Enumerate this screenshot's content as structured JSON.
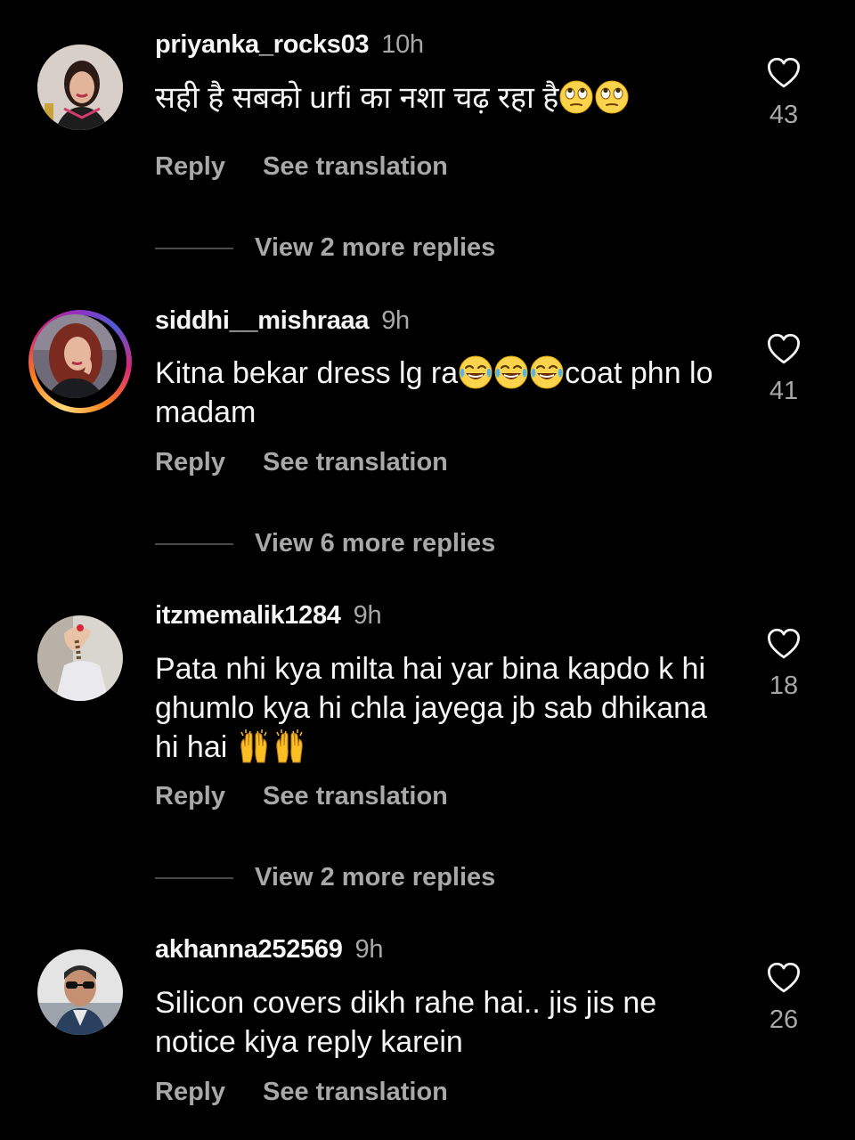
{
  "comments": [
    {
      "username": "priyanka_rocks03",
      "time": "10h",
      "text": "सही है सबको urfi का नशा चढ़ रहा है",
      "emoji": [
        "face-with-rolling-eyes",
        "face-with-rolling-eyes"
      ],
      "likes": "43",
      "reply_label": "Reply",
      "translate_label": "See translation",
      "more_replies": "View 2 more replies",
      "has_story_ring": false
    },
    {
      "username": "siddhi__mishraaa",
      "time": "9h",
      "text_part1": "Kitna bekar dress lg ra",
      "text_part2": "coat phn lo madam",
      "emoji": [
        "face-with-tears-of-joy",
        "face-with-tears-of-joy",
        "face-with-tears-of-joy"
      ],
      "likes": "41",
      "reply_label": "Reply",
      "translate_label": "See translation",
      "more_replies": "View 6 more replies",
      "has_story_ring": true
    },
    {
      "username": "itzmemalik1284",
      "time": "9h",
      "text": "Pata nhi kya milta hai yar bina kapdo k hi ghumlo kya hi chla jayega jb sab dhikana hi hai ",
      "emoji": [
        "raising-hands",
        "raising-hands"
      ],
      "likes": "18",
      "reply_label": "Reply",
      "translate_label": "See translation",
      "more_replies": "View 2 more replies",
      "has_story_ring": false
    },
    {
      "username": "akhanna252569",
      "time": "9h",
      "text": "Silicon covers dikh rahe hai.. jis jis ne notice kiya reply karein",
      "likes": "26",
      "reply_label": "Reply",
      "translate_label": "See translation",
      "has_story_ring": false
    }
  ],
  "colors": {
    "background": "#000000",
    "primary_text": "#f5f5f5",
    "secondary_text": "#a8a8a8",
    "divider": "#4a4a4a"
  },
  "icons": {
    "like": "heart-outline-icon"
  }
}
